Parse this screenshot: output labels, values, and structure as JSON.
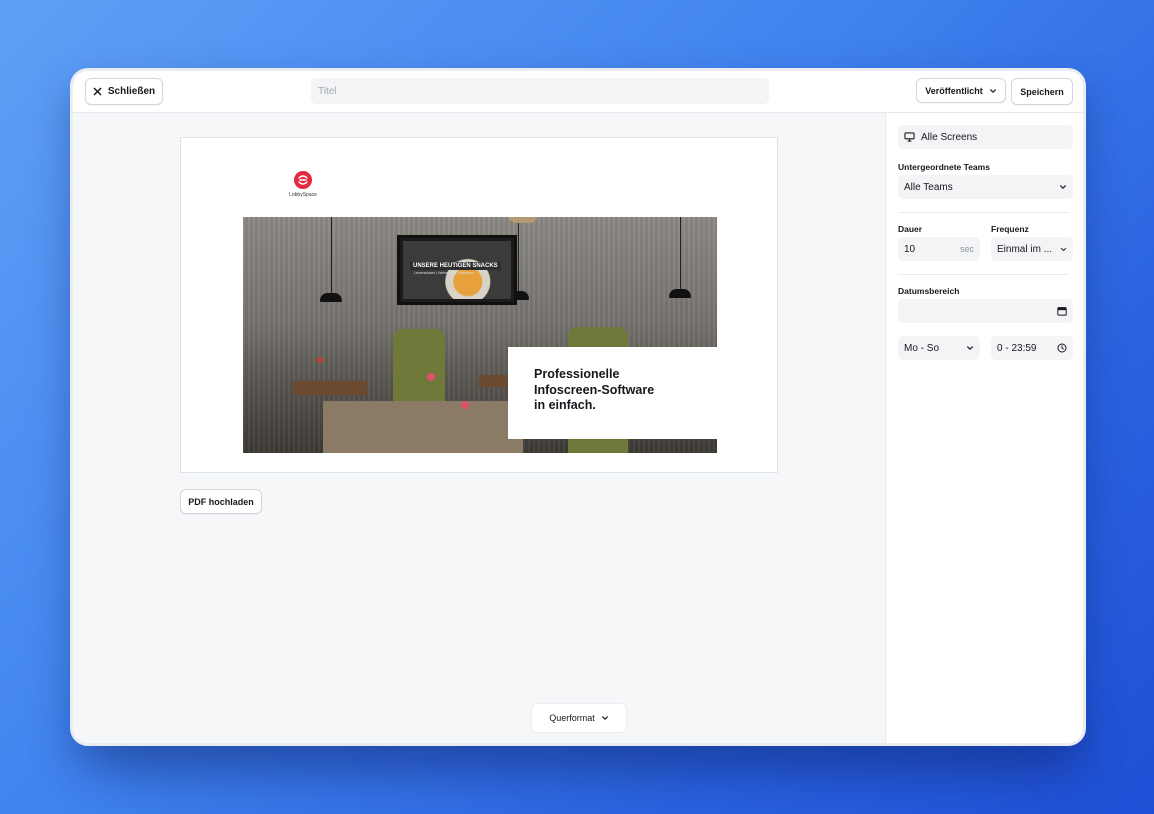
{
  "topbar": {
    "close_label": "Schließen",
    "title_placeholder": "Titel",
    "title_value": "",
    "status_label": "Veröffentlicht",
    "save_label": "Speichern"
  },
  "preview": {
    "logo_text": "LobbySpace",
    "tv_title": "UNSERE HEUTIGEN SNACKS",
    "tv_subtitle": "Leinenwissen | Wetterwelle | Abfahrten",
    "card_text": "Professionelle\nInfoscreen-Software\nin einfach."
  },
  "main": {
    "upload_label": "PDF hochladen",
    "format_label": "Querformat"
  },
  "sidebar": {
    "screens_label": "Alle Screens",
    "teams_heading": "Untergeordnete Teams",
    "teams_value": "Alle Teams",
    "duration_heading": "Dauer",
    "duration_value": "10",
    "duration_unit": "sec",
    "frequency_heading": "Frequenz",
    "frequency_value": "Einmal im ...",
    "daterange_heading": "Datumsbereich",
    "daterange_value": "",
    "days_value": "Mo - So",
    "time_value": "0 - 23:59"
  },
  "colors": {
    "brand_red": "#e6273e",
    "background_blue": "#3f82ee"
  },
  "icons": {
    "close": "close-icon",
    "chevron": "chevron-down-icon",
    "monitor": "monitor-icon",
    "calendar": "calendar-icon",
    "clock": "clock-icon"
  }
}
